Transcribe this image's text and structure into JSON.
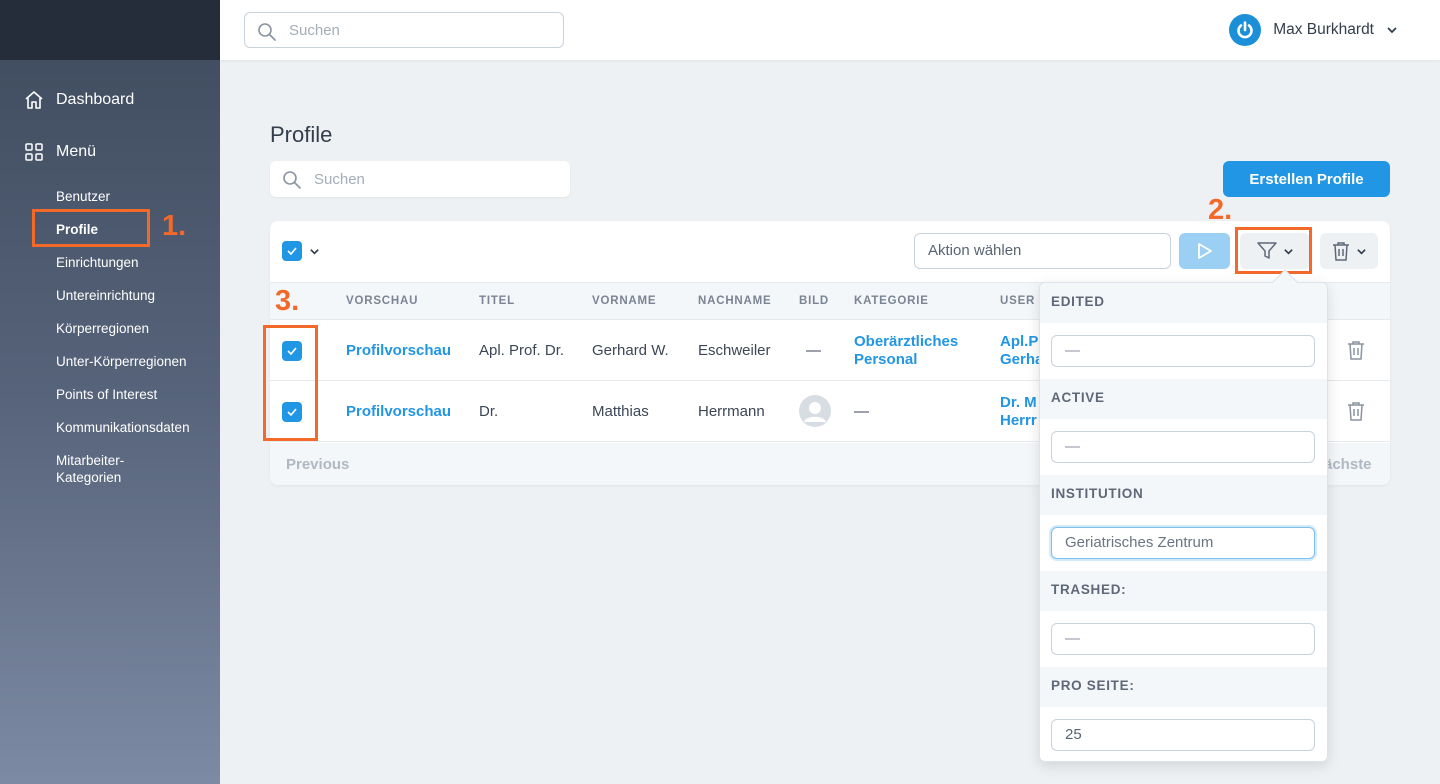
{
  "header": {
    "search_placeholder": "Suchen",
    "user_name": "Max Burkhardt"
  },
  "sidebar": {
    "dashboard": "Dashboard",
    "menu": "Menü",
    "items": [
      {
        "label": "Benutzer"
      },
      {
        "label": "Profile",
        "active": true
      },
      {
        "label": "Einrichtungen"
      },
      {
        "label": "Untereinrichtung"
      },
      {
        "label": "Körperregionen"
      },
      {
        "label": "Unter-Körperregionen"
      },
      {
        "label": "Points of Interest"
      },
      {
        "label": "Kommunikationsdaten"
      },
      {
        "label": "Mitarbeiter-Kategorien"
      }
    ]
  },
  "main": {
    "title": "Profile",
    "search_placeholder": "Suchen",
    "create_label": "Erstellen Profile",
    "action_placeholder": "Aktion wählen",
    "columns": [
      "VORSCHAU",
      "TITEL",
      "VORNAME",
      "NACHNAME",
      "BILD",
      "KATEGORIE",
      "USER"
    ],
    "rows": [
      {
        "vorschau": "Profilvorschau",
        "titel": "Apl. Prof. Dr.",
        "vorname": "Gerhard W.",
        "nachname": "Eschweiler",
        "bild": "—",
        "kategorie": "Oberärztliches Personal",
        "user": "Apl.P\nGerha",
        "checked": true
      },
      {
        "vorschau": "Profilvorschau",
        "titel": "Dr.",
        "vorname": "Matthias",
        "nachname": "Herrmann",
        "bild": "avatar-placeholder",
        "kategorie": "—",
        "user": "Dr. M\nHerrr",
        "checked": true
      }
    ],
    "pagination": {
      "previous": "Previous",
      "next": "ächste"
    }
  },
  "filter_dropdown": {
    "sections": [
      {
        "label": "EDITED",
        "value": "—"
      },
      {
        "label": "ACTIVE",
        "value": "—"
      },
      {
        "label": "INSTITUTION",
        "value": "Geriatrisches Zentrum"
      },
      {
        "label": "TRASHED:",
        "value": "—"
      },
      {
        "label": "PRO SEITE:",
        "value": "25"
      }
    ]
  },
  "annotations": {
    "step1": "1.",
    "step2": "2.",
    "step3": "3."
  },
  "colors": {
    "accent": "#2196e5",
    "annotation": "#f2692a",
    "sidebar_top": "#252d3a"
  }
}
